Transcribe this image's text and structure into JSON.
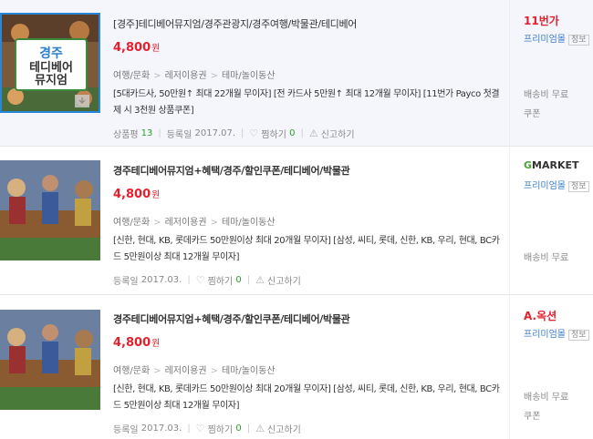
{
  "items": [
    {
      "title": "[경주]테디베어뮤지엄/경주관광지/경주여행/박물관/테디베어",
      "price": "4,800",
      "price_unit": "원",
      "category": [
        "여행/문화",
        "레저이용권",
        "테마/놀이동산"
      ],
      "desc": "[5대카드사, 50만원↑ 최대 22개월 무이자] [전 카드사 5만원↑ 최대 12개월 무이자] [11번가 Payco 첫결제 시 3천원 상품쿠폰]",
      "rating_label": "상품평",
      "rating_count": "13",
      "reg_label": "등록일",
      "reg_date": "2017.07.",
      "wish_label": "찜하기",
      "wish_count": "0",
      "report_label": "신고하기",
      "store_logo": "11번가",
      "premium_label": "프리미엄몰",
      "info_badge": "정보",
      "ship_label": "배송비 무료",
      "coupon_label": "쿠폰",
      "banner_line1": "경주",
      "banner_line2": "테디베어",
      "banner_line3": "뮤지엄"
    },
    {
      "title": "경주테디베어뮤지엄+혜택/경주/할인쿠폰/테디베어/박물관",
      "price": "4,800",
      "price_unit": "원",
      "category": [
        "여행/문화",
        "레저이용권",
        "테마/놀이동산"
      ],
      "desc": "[신한, 현대, KB, 롯데카드 50만원이상 최대 20개월 무이자] [삼성, 씨티, 롯데, 신한, KB, 우리, 현대, BC카드 5만원이상 최대 12개월 무이자]",
      "reg_label": "등록일",
      "reg_date": "2017.03.",
      "wish_label": "찜하기",
      "wish_count": "0",
      "report_label": "신고하기",
      "store_logo_g": "G",
      "store_logo_rest": "MARKET",
      "premium_label": "프리미엄몰",
      "info_badge": "정보",
      "ship_label": "배송비 무료"
    },
    {
      "title": "경주테디베어뮤지엄+혜택/경주/할인쿠폰/테디베어/박물관",
      "price": "4,800",
      "price_unit": "원",
      "category": [
        "여행/문화",
        "레저이용권",
        "테마/놀이동산"
      ],
      "desc": "[신한, 현대, KB, 롯데카드 50만원이상 최대 20개월 무이자] [삼성, 씨티, 롯데, 신한, KB, 우리, 현대, BC카드 5만원이상 최대 12개월 무이자]",
      "reg_label": "등록일",
      "reg_date": "2017.03.",
      "wish_label": "찜하기",
      "wish_count": "0",
      "report_label": "신고하기",
      "store_logo_a": "A.",
      "store_logo_rest": "옥션",
      "premium_label": "프리미엄몰",
      "info_badge": "정보",
      "ship_label": "배송비 무료",
      "coupon_label": "쿠폰"
    }
  ]
}
